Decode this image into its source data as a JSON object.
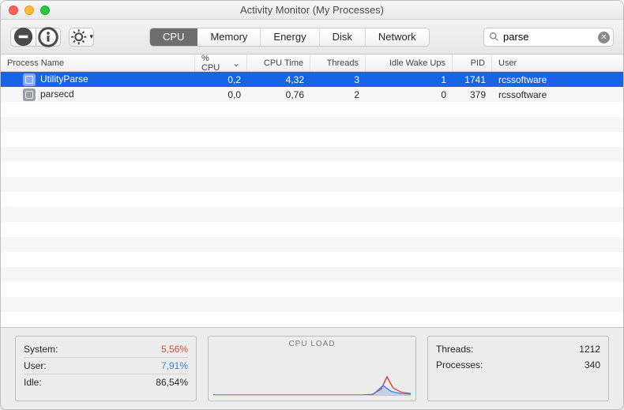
{
  "window": {
    "title": "Activity Monitor (My Processes)"
  },
  "toolbar": {
    "tabs": [
      "CPU",
      "Memory",
      "Energy",
      "Disk",
      "Network"
    ],
    "activeTab": 0
  },
  "search": {
    "placeholder": "Search",
    "value": "parse"
  },
  "columns": {
    "name": "Process Name",
    "cpu": "% CPU",
    "time": "CPU Time",
    "threads": "Threads",
    "wake": "Idle Wake Ups",
    "pid": "PID",
    "user": "User"
  },
  "rows": [
    {
      "name": "UtilityParse",
      "cpu": "0,2",
      "time": "4,32",
      "threads": "3",
      "wake": "1",
      "pid": "1741",
      "user": "rcssoftware",
      "selected": true
    },
    {
      "name": "parsecd",
      "cpu": "0,0",
      "time": "0,76",
      "threads": "2",
      "wake": "0",
      "pid": "379",
      "user": "rcssoftware",
      "selected": false
    }
  ],
  "footer": {
    "system_label": "System:",
    "system_value": "5,56%",
    "user_label": "User:",
    "user_value": "7,91%",
    "idle_label": "Idle:",
    "idle_value": "86,54%",
    "graph_label": "CPU LOAD",
    "threads_label": "Threads:",
    "threads_value": "1212",
    "processes_label": "Processes:",
    "processes_value": "340"
  }
}
